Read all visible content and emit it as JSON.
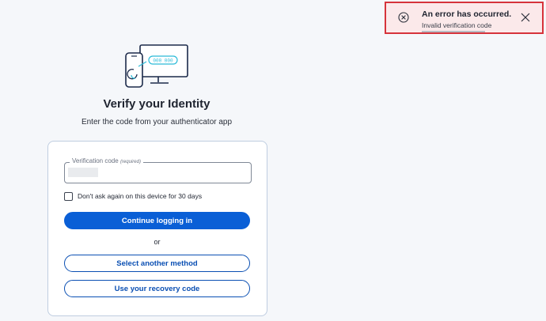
{
  "toast": {
    "title": "An error has occurred.",
    "message": "Invalid verification code",
    "icon": "error-circle-icon",
    "close_icon": "close-icon"
  },
  "illustration": {
    "screen_code": "000 000"
  },
  "page": {
    "title": "Verify your Identity",
    "subtitle": "Enter the code from your authenticator app"
  },
  "form": {
    "field_label": "Verification code",
    "field_required": "(required)",
    "field_value": "",
    "remember_label": "Don't ask again on this device for 30 days",
    "remember_checked": false,
    "continue_label": "Continue logging in",
    "or_label": "or",
    "select_method_label": "Select another method",
    "recovery_label": "Use your recovery code"
  },
  "colors": {
    "primary": "#0a5fd6",
    "error_border": "#d6333b",
    "error_bg": "#fbe9ea",
    "teal_accent": "#2bbbd8"
  }
}
